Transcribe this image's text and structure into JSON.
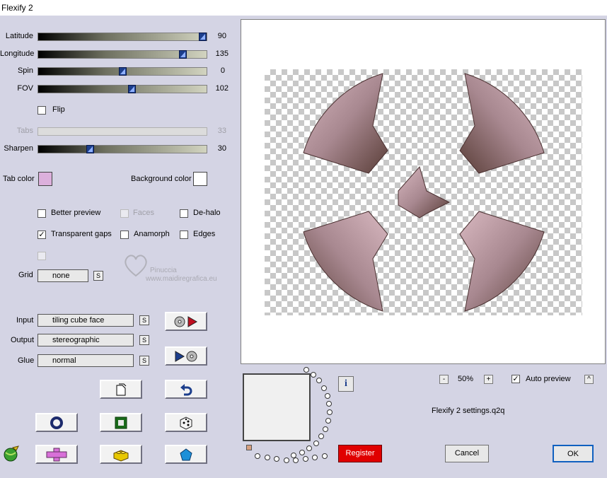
{
  "window": {
    "title": "Flexify 2"
  },
  "sliders": [
    {
      "label": "Latitude",
      "value": "90",
      "level": 1.0,
      "enabled": true
    },
    {
      "label": "Longitude",
      "value": "135",
      "level": 0.875,
      "enabled": true
    },
    {
      "label": "Spin",
      "value": "0",
      "level": 0.5,
      "enabled": true
    },
    {
      "label": "FOV",
      "value": "102",
      "level": 0.56,
      "enabled": true
    },
    {
      "label": "Tabs",
      "value": "33",
      "level": 0.0,
      "enabled": false
    },
    {
      "label": "Sharpen",
      "value": "30",
      "level": 0.3,
      "enabled": true
    }
  ],
  "options": {
    "flip": {
      "label": "Flip",
      "checked": false
    },
    "better_preview": {
      "label": "Better preview",
      "checked": false
    },
    "faces": {
      "label": "Faces",
      "checked": false,
      "enabled": false
    },
    "dehalo": {
      "label": "De-halo",
      "checked": false
    },
    "transparent_gaps": {
      "label": "Transparent gaps",
      "checked": true,
      "mark": "✓"
    },
    "anamorph": {
      "label": "Anamorph",
      "checked": false
    },
    "edges": {
      "label": "Edges",
      "checked": false
    }
  },
  "colors": {
    "tab_color_label": "Tab color",
    "tab_color": "#dcb0dc",
    "background_color_label": "Background color",
    "background_color": "#ffffff",
    "accent_thumb": "#1c3e8c",
    "register_bg": "#e00000"
  },
  "grid": {
    "label": "Grid",
    "value": "none",
    "s_button": "S"
  },
  "projection": {
    "input_label": "Input",
    "input_value": "tiling cube face",
    "output_label": "Output",
    "output_value": "stereographic",
    "glue_label": "Glue",
    "glue_value": "normal",
    "s_button": "S"
  },
  "watermark": {
    "line1": "Pinuccia",
    "line2": "www.maidiregrafica.eu"
  },
  "zoom": {
    "minus": "-",
    "value": "50%",
    "plus": "+"
  },
  "auto_preview": {
    "label": "Auto preview",
    "checked": true,
    "mark": "✓",
    "expand": "^"
  },
  "settings_file": "Flexify 2 settings.q2q",
  "info_icon": "i",
  "buttons": {
    "register": "Register",
    "cancel": "Cancel",
    "ok": "OK"
  },
  "icons": [
    "import-icon",
    "export-icon",
    "new-doc-icon",
    "undo-icon",
    "ring-icon",
    "square-icon",
    "dice-icon",
    "cross-icon",
    "lego-icon",
    "pentagon-icon",
    "globe-icon"
  ]
}
